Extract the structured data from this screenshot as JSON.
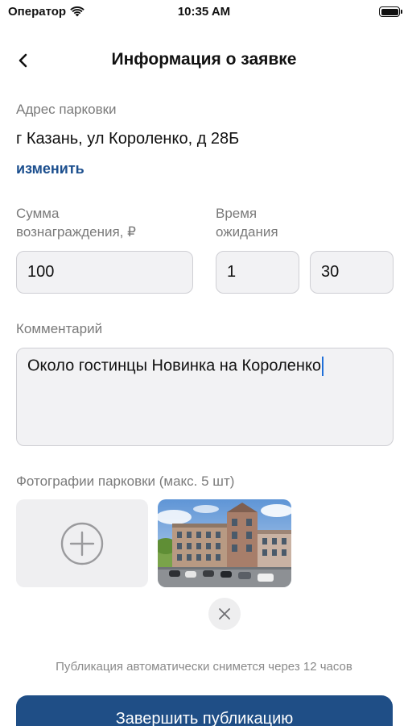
{
  "status_bar": {
    "carrier": "Оператор",
    "time": "10:35 AM"
  },
  "nav": {
    "title": "Информация о заявке",
    "back_icon": "chevron-left-icon"
  },
  "address": {
    "label": "Адрес парковки",
    "value": "г Казань, ул Короленко, д 28Б",
    "change_link": "изменить"
  },
  "reward": {
    "label_line1": "Сумма",
    "label_line2": "вознаграждения, ₽",
    "value": "100"
  },
  "wait_time": {
    "label_line1": "Время",
    "label_line2": "ожидания",
    "hours": "1",
    "minutes": "30"
  },
  "comment": {
    "label": "Комментарий",
    "value": "Около гостинцы Новинка на Короленко"
  },
  "photos": {
    "label": "Фотографии парковки (макс. 5 шт)",
    "add_icon": "plus-circle-icon",
    "remove_icon": "close-icon",
    "count": 1
  },
  "footer": {
    "note": "Публикация автоматически снимется через 12 часов",
    "button": "Завершить публикацию"
  },
  "colors": {
    "accent": "#1f4e86",
    "link": "#1c4f8e",
    "field_bg": "#f2f2f4",
    "field_border": "#cfcfd4"
  }
}
